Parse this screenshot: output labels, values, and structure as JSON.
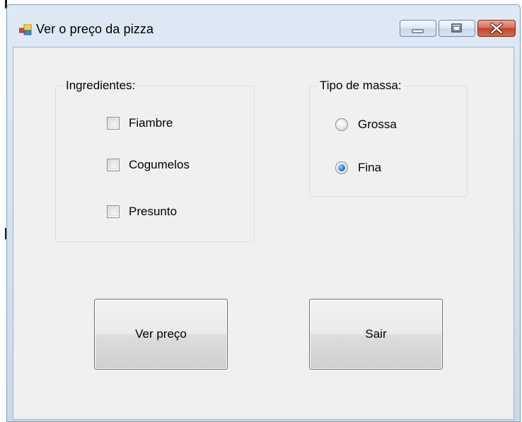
{
  "window": {
    "title": "Ver o preço da pizza",
    "icon": "windows-forms-app-icon",
    "controls": {
      "minimize_icon": "minimize-icon",
      "maximize_icon": "maximize-icon",
      "close_icon": "close-icon"
    }
  },
  "ingredients": {
    "label": "Ingredientes:",
    "items": [
      {
        "label": "Fiambre",
        "checked": false
      },
      {
        "label": "Cogumelos",
        "checked": false
      },
      {
        "label": "Presunto",
        "checked": false
      }
    ]
  },
  "dough": {
    "label": "Tipo de massa:",
    "options": [
      {
        "label": "Grossa",
        "selected": false
      },
      {
        "label": "Fina",
        "selected": true
      }
    ]
  },
  "buttons": {
    "price_label": "Ver preço",
    "exit_label": "Sair"
  },
  "colors": {
    "close_button": "#c2442b",
    "radio_selected": "#2b7fd6",
    "client_background": "#f0f0f0"
  }
}
